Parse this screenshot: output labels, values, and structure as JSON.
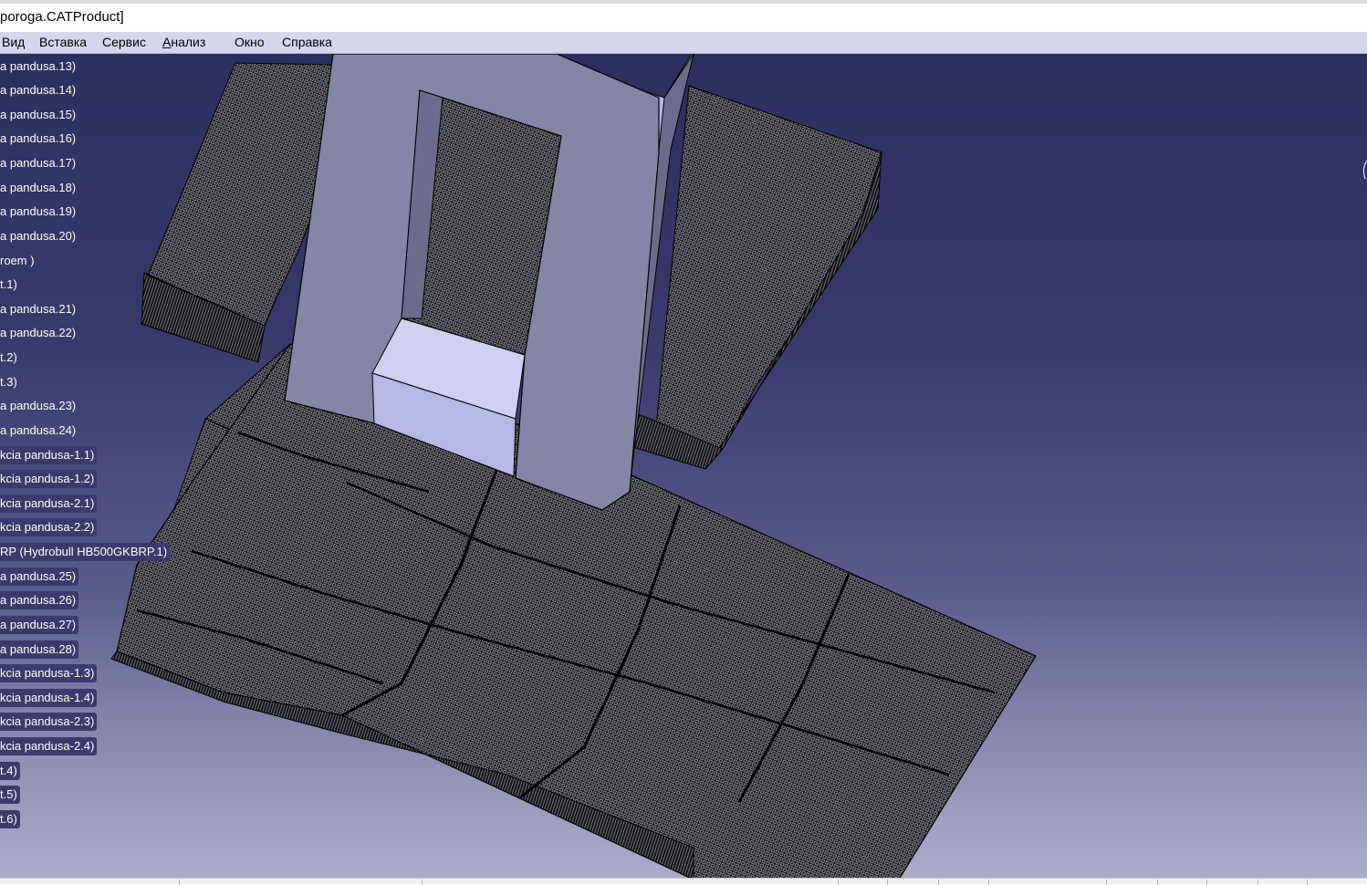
{
  "window": {
    "title": "poroga.CATProduct]"
  },
  "menu": {
    "items": [
      {
        "label": "Вид",
        "accel": ""
      },
      {
        "label": "Вставка",
        "accel": ""
      },
      {
        "label": "Сервис",
        "accel": ""
      },
      {
        "label": "Анализ",
        "accel": "А"
      },
      {
        "label": "Окно",
        "accel": ""
      },
      {
        "label": "Справка",
        "accel": ""
      }
    ]
  },
  "tree": {
    "items": [
      {
        "label": "a pandusa.13)",
        "selected": false
      },
      {
        "label": "a pandusa.14)",
        "selected": false
      },
      {
        "label": "a pandusa.15)",
        "selected": false
      },
      {
        "label": "a pandusa.16)",
        "selected": false
      },
      {
        "label": "a pandusa.17)",
        "selected": false
      },
      {
        "label": "a pandusa.18)",
        "selected": false
      },
      {
        "label": "a pandusa.19)",
        "selected": false
      },
      {
        "label": "a pandusa.20)",
        "selected": false
      },
      {
        "label": "roem )",
        "selected": false
      },
      {
        "label": "t.1)",
        "selected": false
      },
      {
        "label": "a pandusa.21)",
        "selected": false
      },
      {
        "label": "a pandusa.22)",
        "selected": false
      },
      {
        "label": "t.2)",
        "selected": false
      },
      {
        "label": "t.3)",
        "selected": false
      },
      {
        "label": "a pandusa.23)",
        "selected": false
      },
      {
        "label": "a pandusa.24)",
        "selected": false
      },
      {
        "label": "kcia pandusa-1.1)",
        "selected": true
      },
      {
        "label": "kcia pandusa-1.2)",
        "selected": true
      },
      {
        "label": "kcia pandusa-2.1)",
        "selected": true
      },
      {
        "label": "kcia pandusa-2.2)",
        "selected": true
      },
      {
        "label": "RP (Hydrobull HB500GKBRP.1)",
        "selected": true
      },
      {
        "label": "a pandusa.25)",
        "selected": true
      },
      {
        "label": "a pandusa.26)",
        "selected": true
      },
      {
        "label": "a pandusa.27)",
        "selected": true
      },
      {
        "label": "a pandusa.28)",
        "selected": true
      },
      {
        "label": "kcia pandusa-1.3)",
        "selected": true
      },
      {
        "label": "kcia pandusa-1.4)",
        "selected": true
      },
      {
        "label": "kcia pandusa-2.3)",
        "selected": true
      },
      {
        "label": "kcia pandusa-2.4)",
        "selected": true
      },
      {
        "label": "t.4)",
        "selected": true
      },
      {
        "label": "t.5)",
        "selected": true
      },
      {
        "label": "t.6)",
        "selected": true
      }
    ]
  },
  "colors": {
    "mesh_fill": "#1a1a1a",
    "mesh_line": "#c8c8dc",
    "frame_face": "#8585a5",
    "frame_side": "#6c6c8a",
    "frame_top": "#b8b8e6",
    "frame_inner": "#cfcfef",
    "tree_highlight": "#3c3a6d"
  }
}
